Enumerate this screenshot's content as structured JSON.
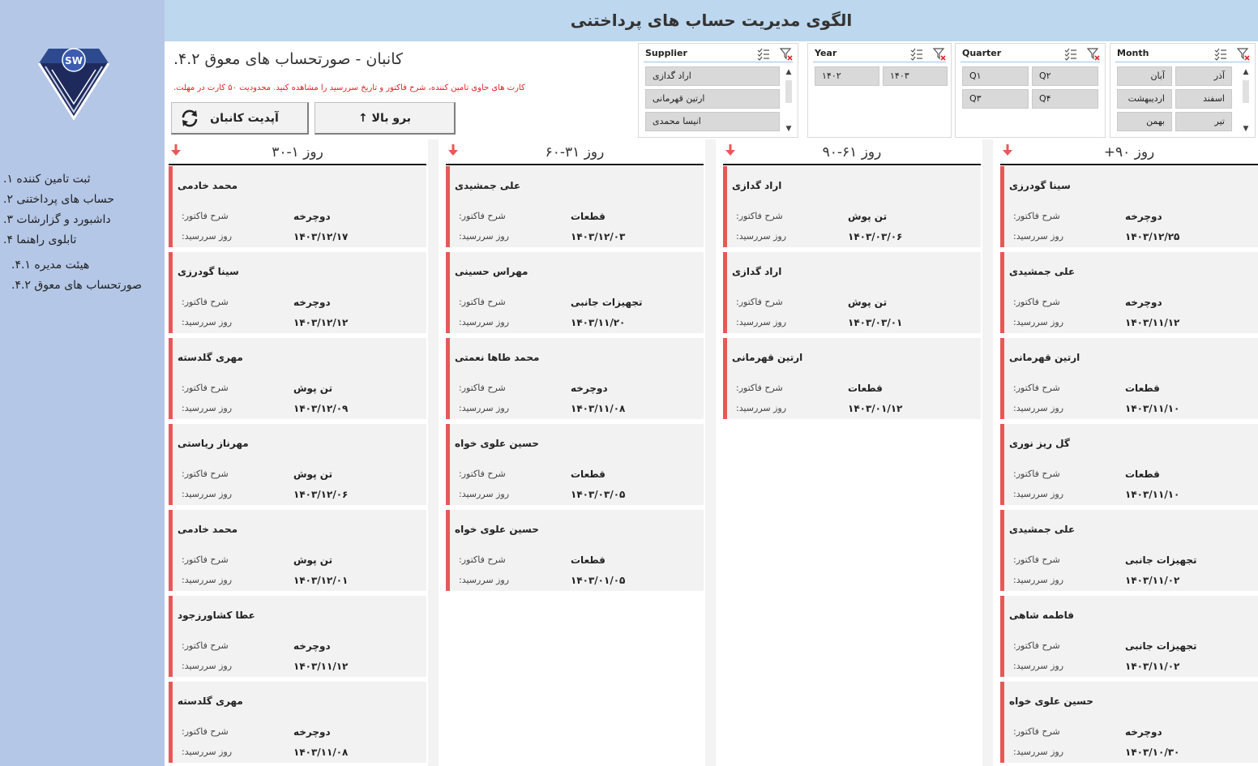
{
  "header": {
    "title": "الگوی مدیریت حساب های پرداختنی"
  },
  "sidebar": {
    "logo_text": "SW",
    "items": [
      {
        "label": "ثبت تامین کننده ۱."
      },
      {
        "label": "حساب های پرداختنی ۲."
      },
      {
        "label": "داشبورد و گزارشات ۳."
      },
      {
        "label": "تابلوی راهنما ۴."
      },
      {
        "label": "هیئت مدیره ۴.۱."
      },
      {
        "label": "صورتحساب های معوق ۴.۲."
      }
    ]
  },
  "page": {
    "title": "کانبان - صورتحساب های معوق ۴.۲.",
    "note": "کارت های حاوی تامین کننده، شرح فاکتور و تاریخ سررسید را مشاهده کنید. محدودیت ۵۰ کارت در مهلت.",
    "update_button": "آپدیت کانبان",
    "top_button": "برو بالا ↑"
  },
  "slicers": {
    "supplier": {
      "title": "Supplier",
      "items": [
        "اراد گدازی",
        "ارتین قهرمانی",
        "انیسا محمدی"
      ]
    },
    "year": {
      "title": "Year",
      "items": [
        "۱۴۰۲",
        "۱۴۰۳"
      ]
    },
    "quarter": {
      "title": "Quarter",
      "items": [
        "Q۱",
        "Q۲",
        "Q۳",
        "Q۴"
      ]
    },
    "month": {
      "title": "Month",
      "items": [
        "آبان",
        "آذر",
        "اردیبهشت",
        "اسفند",
        "بهمن",
        "تیر"
      ]
    }
  },
  "labels": {
    "desc": "شرح فاکتور:",
    "due": "روز سررسید:"
  },
  "columns": [
    {
      "title": "روز ۱-۳۰",
      "cards": [
        {
          "name": "محمد خادمی",
          "desc": "دوچرخه",
          "date": "۱۴۰۳/۱۲/۱۷"
        },
        {
          "name": "سینا گودرزی",
          "desc": "دوچرخه",
          "date": "۱۴۰۳/۱۲/۱۲"
        },
        {
          "name": "مهری گلدسته",
          "desc": "تن پوش",
          "date": "۱۴۰۳/۱۲/۰۹"
        },
        {
          "name": "مهرناز ریاستی",
          "desc": "تن پوش",
          "date": "۱۴۰۳/۱۲/۰۶"
        },
        {
          "name": "محمد خادمی",
          "desc": "تن پوش",
          "date": "۱۴۰۳/۱۲/۰۱"
        },
        {
          "name": "عطا کشاورزجود",
          "desc": "دوچرخه",
          "date": "۱۴۰۳/۱۱/۱۲"
        },
        {
          "name": "مهری گلدسته",
          "desc": "دوچرخه",
          "date": "۱۴۰۳/۱۱/۰۸"
        }
      ]
    },
    {
      "title": "روز ۳۱-۶۰",
      "cards": [
        {
          "name": "علی جمشیدی",
          "desc": "قطعات",
          "date": "۱۴۰۳/۱۲/۰۳"
        },
        {
          "name": "مهراس حسینی",
          "desc": "تجهیزات جانبی",
          "date": "۱۴۰۳/۱۱/۲۰"
        },
        {
          "name": "محمد طاها نعمتی",
          "desc": "دوچرخه",
          "date": "۱۴۰۳/۱۱/۰۸"
        },
        {
          "name": "حسین علوی خواه",
          "desc": "قطعات",
          "date": "۱۴۰۳/۰۳/۰۵"
        },
        {
          "name": "حسین علوی خواه",
          "desc": "قطعات",
          "date": "۱۴۰۳/۰۱/۰۵"
        }
      ]
    },
    {
      "title": "روز ۶۱-۹۰",
      "cards": [
        {
          "name": "اراد گدازی",
          "desc": "تن پوش",
          "date": "۱۴۰۳/۰۳/۰۶"
        },
        {
          "name": "اراد گدازی",
          "desc": "تن پوش",
          "date": "۱۴۰۳/۰۳/۰۱"
        },
        {
          "name": "ارتین قهرمانی",
          "desc": "قطعات",
          "date": "۱۴۰۳/۰۱/۱۲"
        }
      ]
    },
    {
      "title": "روز ۹۰+",
      "cards": [
        {
          "name": "سینا گودرزی",
          "desc": "دوچرخه",
          "date": "۱۴۰۳/۱۲/۲۵"
        },
        {
          "name": "علی جمشیدی",
          "desc": "دوچرخه",
          "date": "۱۴۰۳/۱۱/۱۲"
        },
        {
          "name": "ارتین قهرمانی",
          "desc": "قطعات",
          "date": "۱۴۰۳/۱۱/۱۰"
        },
        {
          "name": "گل ریز نوری",
          "desc": "قطعات",
          "date": "۱۴۰۳/۱۱/۱۰"
        },
        {
          "name": "علی جمشیدی",
          "desc": "تجهیزات جانبی",
          "date": "۱۴۰۳/۱۱/۰۲"
        },
        {
          "name": "فاطمه شاهی",
          "desc": "تجهیزات جانبی",
          "date": "۱۴۰۳/۱۱/۰۲"
        },
        {
          "name": "حسین علوی خواه",
          "desc": "دوچرخه",
          "date": "۱۴۰۳/۱۰/۳۰"
        }
      ]
    }
  ],
  "colors": {
    "accent_red": "#e85858",
    "header_bg": "#bdd7ee",
    "sidebar_bg": "#b4c7e7"
  }
}
